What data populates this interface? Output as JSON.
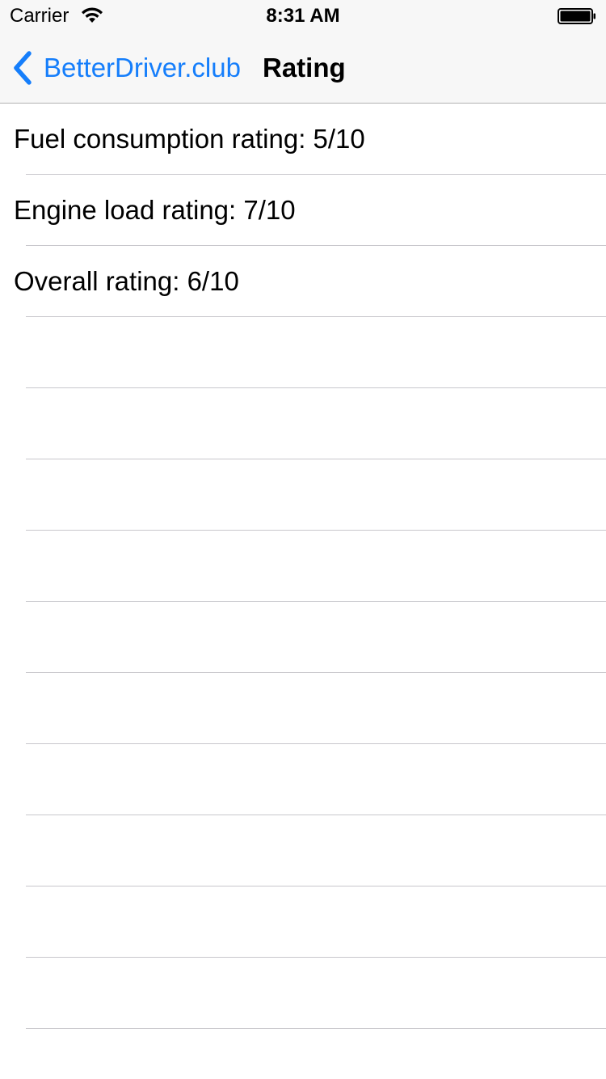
{
  "status_bar": {
    "carrier": "Carrier",
    "time": "8:31 AM",
    "wifi_icon": "wifi-icon",
    "battery_icon": "battery-icon"
  },
  "nav": {
    "back_label": "BetterDriver.club",
    "back_icon": "chevron-left-icon",
    "title": "Rating",
    "accent_color": "#157efb"
  },
  "ratings": [
    {
      "label": "Fuel consumption rating: 5/10"
    },
    {
      "label": "Engine load rating: 7/10"
    },
    {
      "label": "Overall rating: 6/10"
    },
    {
      "label": ""
    },
    {
      "label": ""
    },
    {
      "label": ""
    },
    {
      "label": ""
    },
    {
      "label": ""
    },
    {
      "label": ""
    },
    {
      "label": ""
    },
    {
      "label": ""
    },
    {
      "label": ""
    },
    {
      "label": ""
    }
  ]
}
